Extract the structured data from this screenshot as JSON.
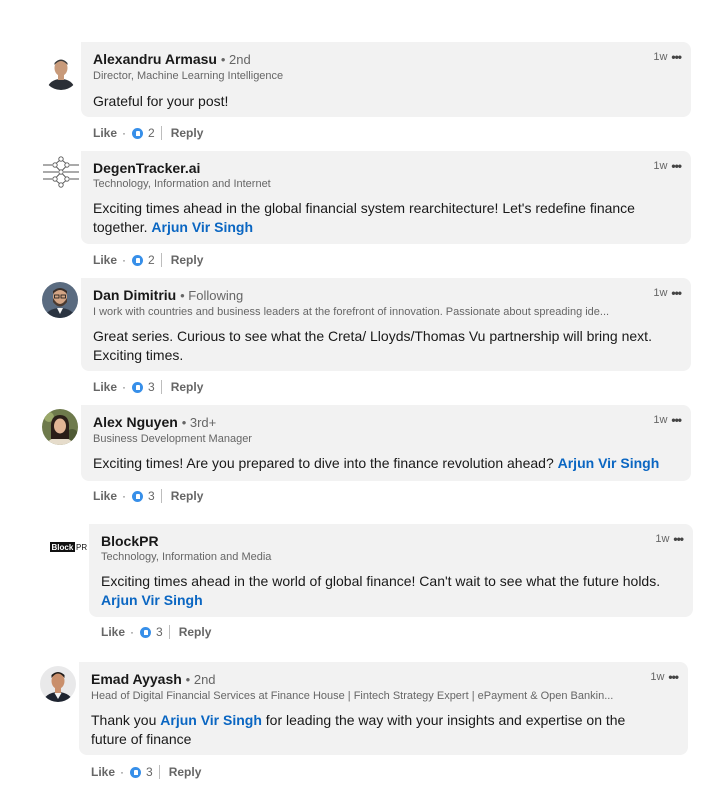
{
  "comments": [
    {
      "name": "Alexandru Armasu",
      "degree": "• 2nd",
      "headline": "Director, Machine Learning Intelligence",
      "text": "Grateful for your post!",
      "mention": "",
      "time": "1w",
      "like_label": "Like",
      "reaction_count": "2",
      "reply_label": "Reply"
    },
    {
      "name": "DegenTracker.ai",
      "degree": "",
      "headline": "Technology, Information and Internet",
      "text": "Exciting times ahead in the global financial system rearchitecture! Let's redefine finance together.",
      "mention": "Arjun Vir Singh",
      "time": "1w",
      "like_label": "Like",
      "reaction_count": "2",
      "reply_label": "Reply"
    },
    {
      "name": "Dan Dimitriu",
      "degree": "• Following",
      "headline": "I work with countries and business leaders at the forefront of innovation. Passionate about spreading ide...",
      "text": "Great series. Curious to see what the Creta/ Lloyds/Thomas Vu partnership will bring next. Exciting times.",
      "mention": "",
      "time": "1w",
      "like_label": "Like",
      "reaction_count": "3",
      "reply_label": "Reply"
    },
    {
      "name": "Alex Nguyen",
      "degree": "• 3rd+",
      "headline": "Business Development Manager",
      "text": "Exciting times! Are you prepared to dive into the finance revolution ahead?",
      "mention": "Arjun Vir Singh",
      "time": "1w",
      "like_label": "Like",
      "reaction_count": "3",
      "reply_label": "Reply"
    },
    {
      "name": "BlockPR",
      "degree": "",
      "headline": "Technology, Information and Media",
      "text": "Exciting times ahead in the world of global finance! Can't wait to see what the future holds.",
      "mention": "Arjun Vir Singh",
      "time": "1w",
      "like_label": "Like",
      "reaction_count": "3",
      "reply_label": "Reply",
      "logo_text": "BlockPR"
    },
    {
      "name": "Emad Ayyash",
      "degree": "• 2nd",
      "headline": "Head of Digital Financial Services at Finance House | Fintech Strategy Expert | ePayment & Open Bankin...",
      "text_before": "Thank you",
      "mention": "Arjun Vir Singh",
      "text_after": "for leading the way with your insights and expertise on the future of finance",
      "time": "1w",
      "like_label": "Like",
      "reaction_count": "3",
      "reply_label": "Reply"
    }
  ],
  "colors": {
    "bubble_bg": "#f2f2f2",
    "mention": "#0a66c2",
    "secondary_text": "#666666",
    "reaction_blue": "#378fe9"
  }
}
